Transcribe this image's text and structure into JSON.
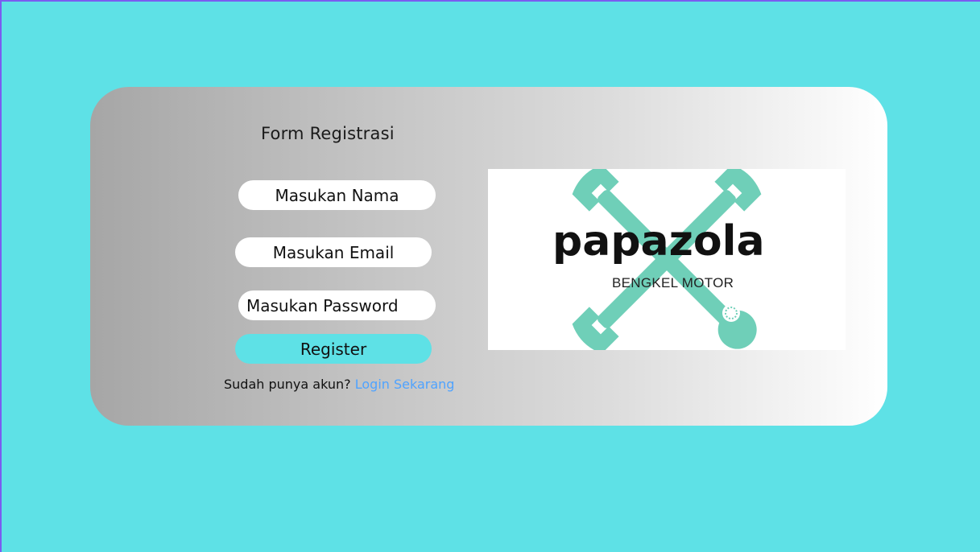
{
  "form": {
    "title": "Form Registrasi",
    "name_placeholder": "Masukan Nama",
    "email_placeholder": "Masukan Email",
    "password_placeholder": "Masukan Password",
    "register_label": "Register",
    "login_prompt": "Sudah punya akun?",
    "login_link": "Login Sekarang"
  },
  "logo": {
    "brand": "papazola",
    "tagline": "BENGKEL MOTOR",
    "icon": "crossed-wrenches-icon",
    "icon_color": "#6fcfb8"
  },
  "colors": {
    "background": "#5ee1e6",
    "button": "#5ee1e6",
    "link": "#4fa3ff"
  }
}
